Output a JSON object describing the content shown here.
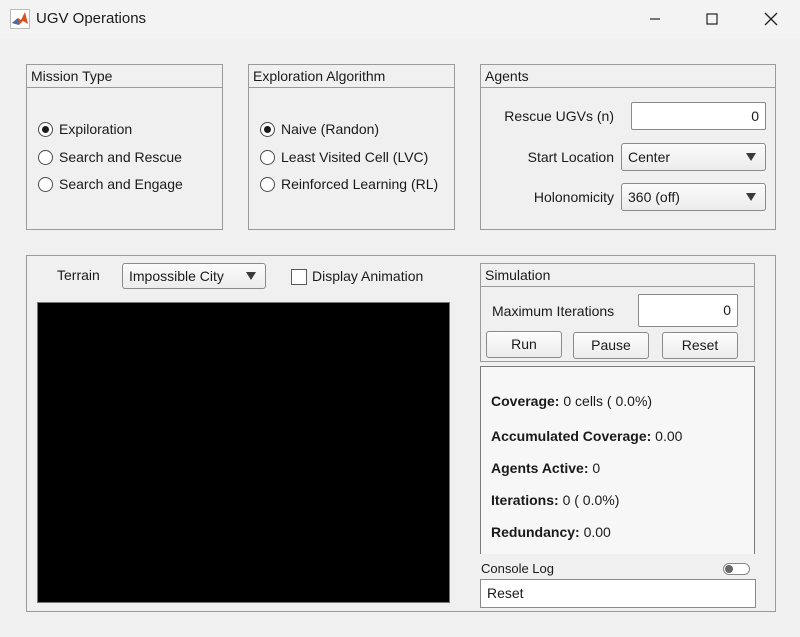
{
  "window": {
    "title": "UGV Operations",
    "icon": "matlab-logo-icon"
  },
  "mission": {
    "title": "Mission Type",
    "options": [
      {
        "label": "Expiloration",
        "selected": true
      },
      {
        "label": "Search and Rescue",
        "selected": false
      },
      {
        "label": "Search and Engage",
        "selected": false
      }
    ]
  },
  "algorithm": {
    "title": "Exploration Algorithm",
    "options": [
      {
        "label": "Naive (Randon)",
        "selected": true
      },
      {
        "label": "Least Visited Cell (LVC)",
        "selected": false
      },
      {
        "label": "Reinforced Learning (RL)",
        "selected": false
      }
    ]
  },
  "agents": {
    "title": "Agents",
    "rescue_label": "Rescue UGVs (n)",
    "rescue_value": "0",
    "start_label": "Start Location",
    "start_value": "Center",
    "holo_label": "Holonomicity",
    "holo_value": "360 (off)"
  },
  "view": {
    "terrain_label": "Terrain",
    "terrain_value": "Impossible City",
    "animation_label": "Display Animation",
    "animation_checked": false
  },
  "simulation": {
    "title": "Simulation",
    "max_iter_label": "Maximum Iterations",
    "max_iter_value": "0",
    "run_label": "Run",
    "pause_label": "Pause",
    "reset_label": "Reset"
  },
  "stats": {
    "coverage_label": "Coverage:",
    "coverage_value": "0 cells ( 0.0%)",
    "accum_label": "Accumulated Coverage:",
    "accum_value": "0.00",
    "agents_label": "Agents Active:",
    "agents_value": "0",
    "iter_label": "Iterations:",
    "iter_value": "0 ( 0.0%)",
    "redund_label": "Redundancy:",
    "redund_value": "0.00"
  },
  "console": {
    "label": "Console Log",
    "toggle_on": false,
    "text": "Reset"
  }
}
